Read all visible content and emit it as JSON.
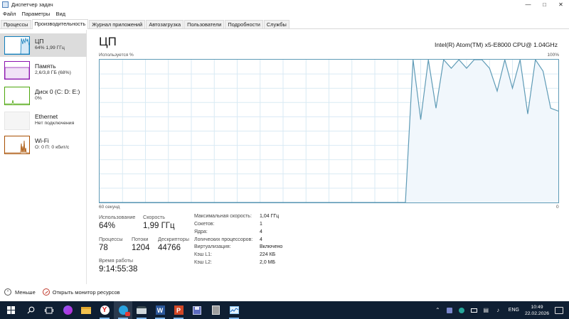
{
  "window": {
    "title": "Диспетчер задач"
  },
  "menu": [
    "Файл",
    "Параметры",
    "Вид"
  ],
  "tabs": [
    {
      "label": "Процессы",
      "active": false
    },
    {
      "label": "Производительность",
      "active": true
    },
    {
      "label": "Журнал приложений",
      "active": false
    },
    {
      "label": "Автозагрузка",
      "active": false
    },
    {
      "label": "Пользователи",
      "active": false
    },
    {
      "label": "Подробности",
      "active": false
    },
    {
      "label": "Службы",
      "active": false
    }
  ],
  "sidebar": [
    {
      "name": "ЦП",
      "sub": "64% 1,99 ГГц",
      "color": "#117dbb",
      "active": true
    },
    {
      "name": "Память",
      "sub": "2,6/3,8 ГБ (68%)",
      "color": "#8b12ae",
      "active": false
    },
    {
      "name": "Диск 0 (C: D: E:)",
      "sub": "0%",
      "color": "#4da60c",
      "active": false
    },
    {
      "name": "Ethernet",
      "sub": "Нет подключения",
      "color": "#bdbdbd",
      "active": false
    },
    {
      "name": "Wi-Fi",
      "sub": "О: 0 П: 0 кбит/с",
      "color": "#a74f01",
      "active": false
    }
  ],
  "main": {
    "title": "ЦП",
    "model": "Intel(R) Atom(TM) x5-E8000 CPU@ 1.04GHz",
    "graph_label_top_left": "Используется %",
    "graph_label_top_right": "100%",
    "graph_label_bottom_left": "60 секунд",
    "graph_label_bottom_right": "0"
  },
  "stats": {
    "usage_label": "Использование",
    "usage_value": "64%",
    "speed_label": "Скорость",
    "speed_value": "1,99 ГГц",
    "processes_label": "Процессы",
    "processes_value": "78",
    "threads_label": "Потоки",
    "threads_value": "1204",
    "handles_label": "Дескрипторы",
    "handles_value": "44766",
    "uptime_label": "Время работы",
    "uptime_value": "9:14:55:38"
  },
  "specs": [
    {
      "label": "Максимальная скорость:",
      "value": "1,04 ГГц"
    },
    {
      "label": "Сокетов:",
      "value": "1"
    },
    {
      "label": "Ядра:",
      "value": "4"
    },
    {
      "label": "Логических процессоров:",
      "value": "4"
    },
    {
      "label": "Виртуализация:",
      "value": "Включено"
    },
    {
      "label": "Кэш L1:",
      "value": "224 КБ"
    },
    {
      "label": "Кэш L2:",
      "value": "2,0 МБ"
    }
  ],
  "bottom": {
    "less_label": "Меньше",
    "resmon_label": "Открыть монитор ресурсов"
  },
  "taskbar": {
    "lang": "ENG",
    "time": "10:49",
    "date": "22.02.2026"
  },
  "chart_data": {
    "type": "line",
    "ylabel": "Используется %",
    "xlabel": "60 секунд",
    "ylim": [
      0,
      100
    ],
    "xlim": [
      60,
      0
    ],
    "x": [
      60,
      20,
      19,
      18,
      17,
      16,
      15,
      14,
      13,
      12,
      11,
      10,
      9,
      8,
      7,
      6,
      5,
      4,
      3,
      2,
      1,
      0
    ],
    "y": [
      0,
      0,
      100,
      58,
      100,
      66,
      100,
      94,
      100,
      94,
      100,
      100,
      94,
      78,
      100,
      80,
      100,
      62,
      100,
      92,
      66,
      64
    ],
    "grid": true,
    "color": "#117dbb"
  }
}
